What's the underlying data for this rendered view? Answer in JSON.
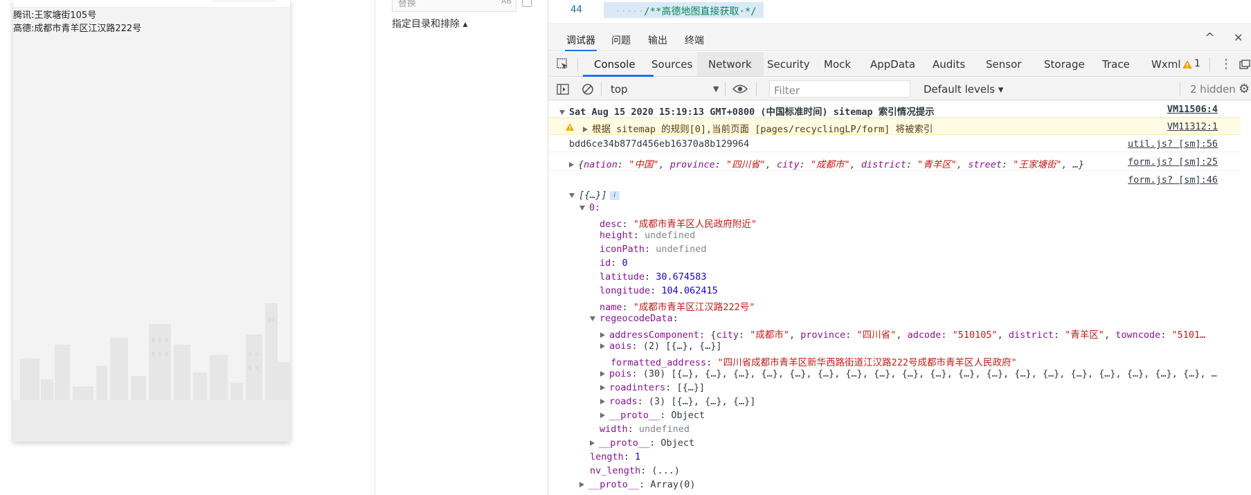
{
  "simulator": {
    "tencent_label": "腾讯:",
    "tencent_address": "王家塘街105号",
    "amap_label": "高德:",
    "amap_address": "成都市青羊区江汉路222号"
  },
  "middle": {
    "replace_placeholder": "替换",
    "ab_label": "AB",
    "dir_exclude_link": "指定目录和排除 ▴"
  },
  "editor": {
    "line_number": "44",
    "dots": "·····",
    "comment": "/**高德地图直接获取·*/"
  },
  "panel_tabs": [
    "调试器",
    "问题",
    "输出",
    "终端"
  ],
  "panel_controls": {
    "collapse": "^",
    "close": "✕"
  },
  "devtools_tabs": [
    "Console",
    "Sources",
    "Network",
    "Security",
    "Mock",
    "AppData",
    "Audits",
    "Sensor",
    "Storage",
    "Trace",
    "Wxml"
  ],
  "devtools": {
    "warning_count": "1",
    "kebab": "⋮"
  },
  "toolbar": {
    "context": "top",
    "filter_placeholder": "Filter",
    "levels": "Default levels ▾",
    "hidden": "2 hidden"
  },
  "console": {
    "group_header": "Sat Aug 15 2020 15:19:13 GMT+0800 (中国标准时间) sitemap 索引情况提示",
    "group_src": "VM11506:4",
    "warning_text": "根据 sitemap 的规则[0],当前页面 [pages/recyclingLP/form] 将被索引",
    "warning_src": "VM11312:1",
    "id_text": "bdd6ce34b877d456eb16370a8b129964",
    "id_src": "util.js? [sm]:56",
    "obj_preview": {
      "nation_key": "nation",
      "nation_val": "\"中国\"",
      "province_key": "province",
      "province_val": "\"四川省\"",
      "city_key": "city",
      "city_val": "\"成都市\"",
      "district_key": "district",
      "district_val": "\"青羊区\"",
      "street_key": "street",
      "street_val": "\"王家塘街\"",
      "tail": ", …}"
    },
    "obj_src": "form.js? [sm]:25",
    "array_src": "form.js? [sm]:46",
    "array_preview": "[{…}]",
    "info_badge": "i",
    "item_index": "0:",
    "desc_key": "desc",
    "desc_val": "\"成都市青羊区人民政府附近\"",
    "height_key": "height",
    "height_val": "undefined",
    "iconPath_key": "iconPath",
    "iconPath_val": "undefined",
    "id_key": "id",
    "id_val": "0",
    "latitude_key": "latitude",
    "latitude_val": "30.674583",
    "longitude_key": "longitude",
    "longitude_val": "104.062415",
    "name_key": "name",
    "name_val": "\"成都市青羊区江汉路222号\"",
    "regeo_key": "regeocodeData",
    "addr_key": "addressComponent",
    "addr_city_key": "city",
    "addr_city_val": "\"成都市\"",
    "addr_province_key": "province",
    "addr_province_val": "\"四川省\"",
    "addr_adcode_key": "adcode",
    "addr_adcode_val": "\"510105\"",
    "addr_district_key": "district",
    "addr_district_val": "\"青羊区\"",
    "addr_towncode_key": "towncode",
    "addr_towncode_val": "\"5101…",
    "aois_key": "aois",
    "aois_val": "(2) [{…}, {…}]",
    "formatted_key": "formatted_address",
    "formatted_val": "\"四川省成都市青羊区新华西路街道江汉路222号成都市青羊区人民政府\"",
    "pois_key": "pois",
    "pois_val": "(30) [{…}, {…}, {…}, {…}, {…}, {…}, {…}, {…}, {…}, {…}, {…}, {…}, {…}, {…}, {…}, {…}, {…}, {…}, {…}, …",
    "roadinters_key": "roadinters",
    "roadinters_val": "[{…}]",
    "roads_key": "roads",
    "roads_val": "(3) [{…}, {…}, {…}]",
    "proto_key": "__proto__",
    "proto_obj_val": "Object",
    "width_key": "width",
    "width_val": "undefined",
    "length_key": "length",
    "length_val": "1",
    "nvlength_key": "nv_length",
    "nvlength_val": "(...)",
    "proto_arr_val": "Array(0)"
  },
  "colors": {
    "accent": "#1a73e8",
    "string": "#c41a16",
    "key": "#881391",
    "number": "#1c00cf",
    "warning_bg": "#fffbe5",
    "warning_icon": "#f2a600"
  }
}
